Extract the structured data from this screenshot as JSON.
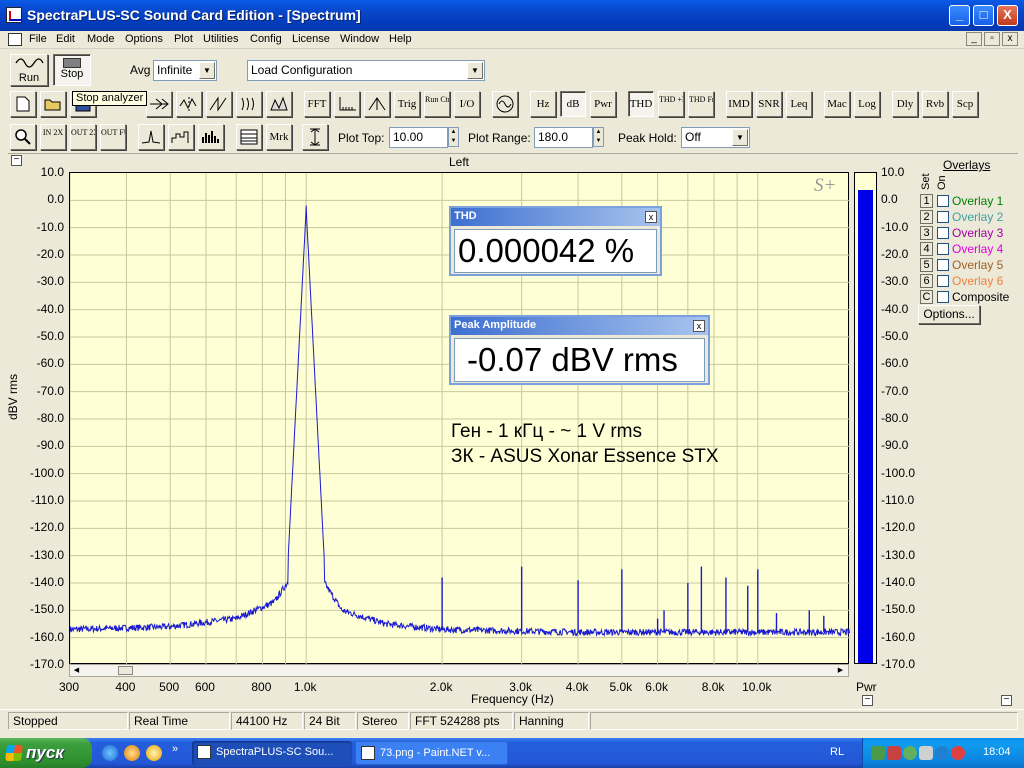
{
  "window": {
    "title": "SpectraPLUS-SC Sound Card Edition - [Spectrum]",
    "buttons": {
      "minimize": "_",
      "maximize": "□",
      "close": "X"
    }
  },
  "menubar": {
    "items": [
      "File",
      "Edit",
      "Mode",
      "Options",
      "Plot",
      "Utilities",
      "Config",
      "License",
      "Window",
      "Help"
    ],
    "child_buttons": [
      "_",
      "▫",
      "x"
    ]
  },
  "toolbar1": {
    "run_label": "Run",
    "stop_label": "Stop",
    "avg_label": "Avg",
    "avg_value": "Infinite",
    "config_value": "Load Configuration"
  },
  "tooltip": "Stop analyzer",
  "toolbar2": {
    "buttons": [
      "FFT",
      "Trig",
      "Run Ctrl",
      "I/O",
      "Hz",
      "dB",
      "Pwr",
      "THD",
      "THD +N",
      "THD Freq",
      "IMD",
      "SNR",
      "Leq",
      "Mac",
      "Log",
      "Dly",
      "Rvb",
      "Scp"
    ]
  },
  "toolbar3": {
    "zoom_buttons": [
      "IN 2X",
      "OUT 2X",
      "OUT FULL"
    ],
    "mrk": "Mrk",
    "plot_top_label": "Plot Top:",
    "plot_top_value": "10.00",
    "plot_range_label": "Plot Range:",
    "plot_range_value": "180.0",
    "peak_hold_label": "Peak Hold:",
    "peak_hold_value": "Off"
  },
  "plot": {
    "channel": "Left",
    "logo": "S+",
    "ylabel": "dBV rms",
    "xlabel": "Frequency (Hz)",
    "yticks": [
      "10.0",
      "0.0",
      "-10.0",
      "-20.0",
      "-30.0",
      "-40.0",
      "-50.0",
      "-60.0",
      "-70.0",
      "-80.0",
      "-90.0",
      "-100.0",
      "-110.0",
      "-120.0",
      "-130.0",
      "-140.0",
      "-150.0",
      "-160.0",
      "-170.0"
    ],
    "xticks": [
      "300",
      "400",
      "500",
      "600",
      "800",
      "1.0k",
      "2.0k",
      "3.0k",
      "4.0k",
      "5.0k",
      "6.0k",
      "8.0k",
      "10.0k"
    ],
    "annotation_line1": "Ген - 1 кГц -   ~ 1 V rms",
    "annotation_line2": "ЗК  -  ASUS Xonar Essence STX"
  },
  "chart_data": {
    "type": "line",
    "title": "",
    "xlabel": "Frequency (Hz)",
    "ylabel": "dBV rms",
    "xscale": "log",
    "xlim": [
      300,
      16000
    ],
    "ylim": [
      -170,
      10
    ],
    "grid": true,
    "series": [
      {
        "noise_floor": [
          [
            300,
            -157
          ],
          [
            500,
            -156
          ],
          [
            700,
            -153
          ],
          [
            850,
            -147
          ],
          [
            950,
            -135
          ],
          [
            1000,
            0
          ],
          [
            1050,
            -135
          ],
          [
            1200,
            -150
          ],
          [
            1500,
            -155
          ],
          [
            2000,
            -157
          ],
          [
            4000,
            -158
          ],
          [
            8000,
            -158
          ],
          [
            16000,
            -158
          ]
        ],
        "harmonics": [
          [
            1000,
            -0.07
          ],
          [
            2000,
            -138
          ],
          [
            3000,
            -134
          ],
          [
            4000,
            -139
          ],
          [
            5000,
            -135
          ],
          [
            6000,
            -153
          ],
          [
            6200,
            -150
          ],
          [
            7000,
            -140
          ],
          [
            7500,
            -134
          ],
          [
            8500,
            -138
          ],
          [
            9500,
            -141
          ],
          [
            10000,
            -135
          ],
          [
            11000,
            -151
          ],
          [
            13000,
            -150
          ],
          [
            14000,
            -152
          ]
        ]
      }
    ]
  },
  "meters": {
    "thd": {
      "title": "THD",
      "value": "0.000042 %"
    },
    "peak": {
      "title": "Peak Amplitude",
      "value": "-0.07 dBV rms"
    }
  },
  "powerbar": {
    "label": "Pwr",
    "level_db": 0,
    "ticks": [
      "10.0",
      "0.0",
      "-10.0",
      "-20.0",
      "-30.0",
      "-40.0",
      "-50.0",
      "-60.0",
      "-70.0",
      "-80.0",
      "-90.0",
      "-100.0",
      "-110.0",
      "-120.0",
      "-130.0",
      "-140.0",
      "-150.0",
      "-160.0",
      "-170.0"
    ]
  },
  "overlays": {
    "title": "Overlays",
    "set_label": "Set",
    "on_label": "On",
    "rows": [
      {
        "num": "1",
        "name": "Overlay 1",
        "color": "#008000"
      },
      {
        "num": "2",
        "name": "Overlay 2",
        "color": "#3FA0A0"
      },
      {
        "num": "3",
        "name": "Overlay 3",
        "color": "#A000A0"
      },
      {
        "num": "4",
        "name": "Overlay 4",
        "color": "#E000E0"
      },
      {
        "num": "5",
        "name": "Overlay 5",
        "color": "#A06020"
      },
      {
        "num": "6",
        "name": "Overlay 6",
        "color": "#F08040"
      },
      {
        "num": "C",
        "name": "Composite",
        "color": "#000000"
      }
    ],
    "options_button": "Options..."
  },
  "status": {
    "cells": [
      "Stopped",
      "Real Time",
      "44100 Hz",
      "24 Bit",
      "Stereo",
      "FFT 524288 pts",
      "Hanning"
    ]
  },
  "taskbar": {
    "start_label": "пуск",
    "tasks": [
      "SpectraPLUS-SC Sou...",
      "73.png - Paint.NET v..."
    ],
    "lang": "RL",
    "clock": "18:04"
  }
}
